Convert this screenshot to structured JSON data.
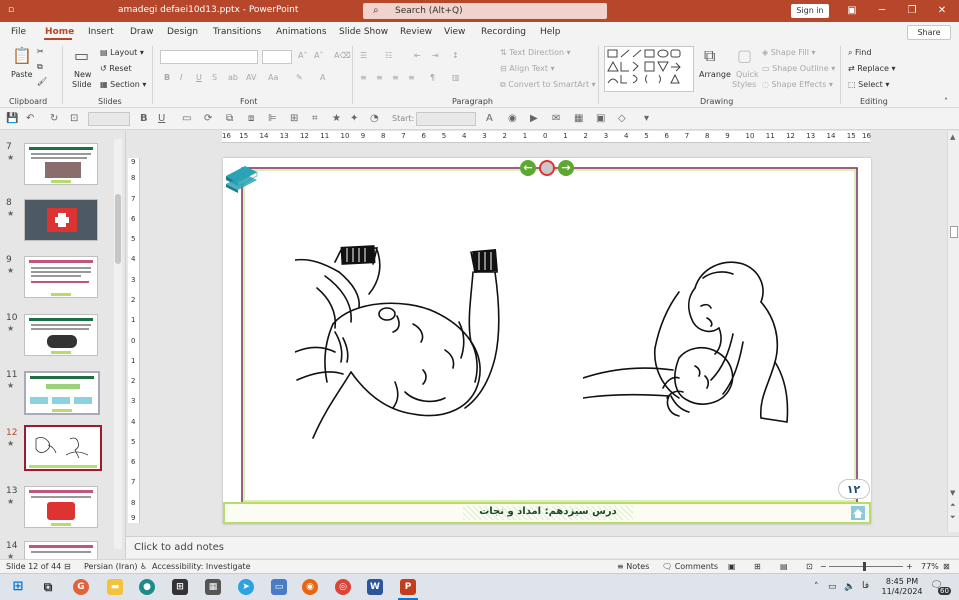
{
  "window": {
    "title": "amadegi defaei10d13.pptx  -  PowerPoint",
    "search_placeholder": "Search (Alt+Q)",
    "signin_label": "Sign in"
  },
  "ribbon_tabs": [
    "File",
    "Home",
    "Insert",
    "Draw",
    "Design",
    "Transitions",
    "Animations",
    "Slide Show",
    "Review",
    "View",
    "Recording",
    "Help"
  ],
  "active_tab": "Home",
  "share_label": "Share",
  "ribbon": {
    "clipboard": {
      "label": "Clipboard",
      "paste": "Paste"
    },
    "slides": {
      "label": "Slides",
      "new_slide_1": "New",
      "new_slide_2": "Slide",
      "layout": "Layout",
      "reset": "Reset",
      "section": "Section"
    },
    "font": {
      "label": "Font"
    },
    "paragraph": {
      "label": "Paragraph",
      "text_direction": "Text Direction",
      "align_text": "Align Text",
      "convert_smartart": "Convert to SmartArt"
    },
    "drawing": {
      "label": "Drawing",
      "arrange": "Arrange",
      "quick_styles_1": "Quick",
      "quick_styles_2": "Styles",
      "shape_fill": "Shape Fill",
      "shape_outline": "Shape Outline",
      "shape_effects": "Shape Effects"
    },
    "editing": {
      "label": "Editing",
      "find": "Find",
      "replace": "Replace",
      "select": "Select"
    }
  },
  "qat": {
    "start_label": "Start:"
  },
  "ruler": {
    "h": [
      "16",
      "15",
      "14",
      "13",
      "12",
      "11",
      "10",
      "9",
      "8",
      "7",
      "6",
      "5",
      "4",
      "3",
      "2",
      "1",
      "0",
      "1",
      "2",
      "3",
      "4",
      "5",
      "6",
      "7",
      "8",
      "9",
      "10",
      "11",
      "12",
      "13",
      "14",
      "15",
      "16"
    ],
    "v": [
      "9",
      "8",
      "7",
      "6",
      "5",
      "4",
      "3",
      "2",
      "1",
      "0",
      "1",
      "2",
      "3",
      "4",
      "5",
      "6",
      "7",
      "8",
      "9"
    ]
  },
  "thumbnails": [
    {
      "num": "7"
    },
    {
      "num": "8"
    },
    {
      "num": "9"
    },
    {
      "num": "10"
    },
    {
      "num": "11"
    },
    {
      "num": "12",
      "selected": true
    },
    {
      "num": "13"
    },
    {
      "num": "14"
    }
  ],
  "slide": {
    "page_number": "۱۲",
    "footer_title": "درس سیزدهم: امداد و نجات"
  },
  "notes_placeholder": "Click to add notes",
  "status": {
    "slide_info": "Slide 12 of 44",
    "language": "Persian (Iran)",
    "accessibility": "Accessibility: Investigate",
    "notes": "Notes",
    "comments": "Comments",
    "zoom": "77%"
  },
  "taskbar": {
    "lang": "فا",
    "time": "8:45 PM",
    "date": "11/4/2024",
    "badge": "60"
  }
}
